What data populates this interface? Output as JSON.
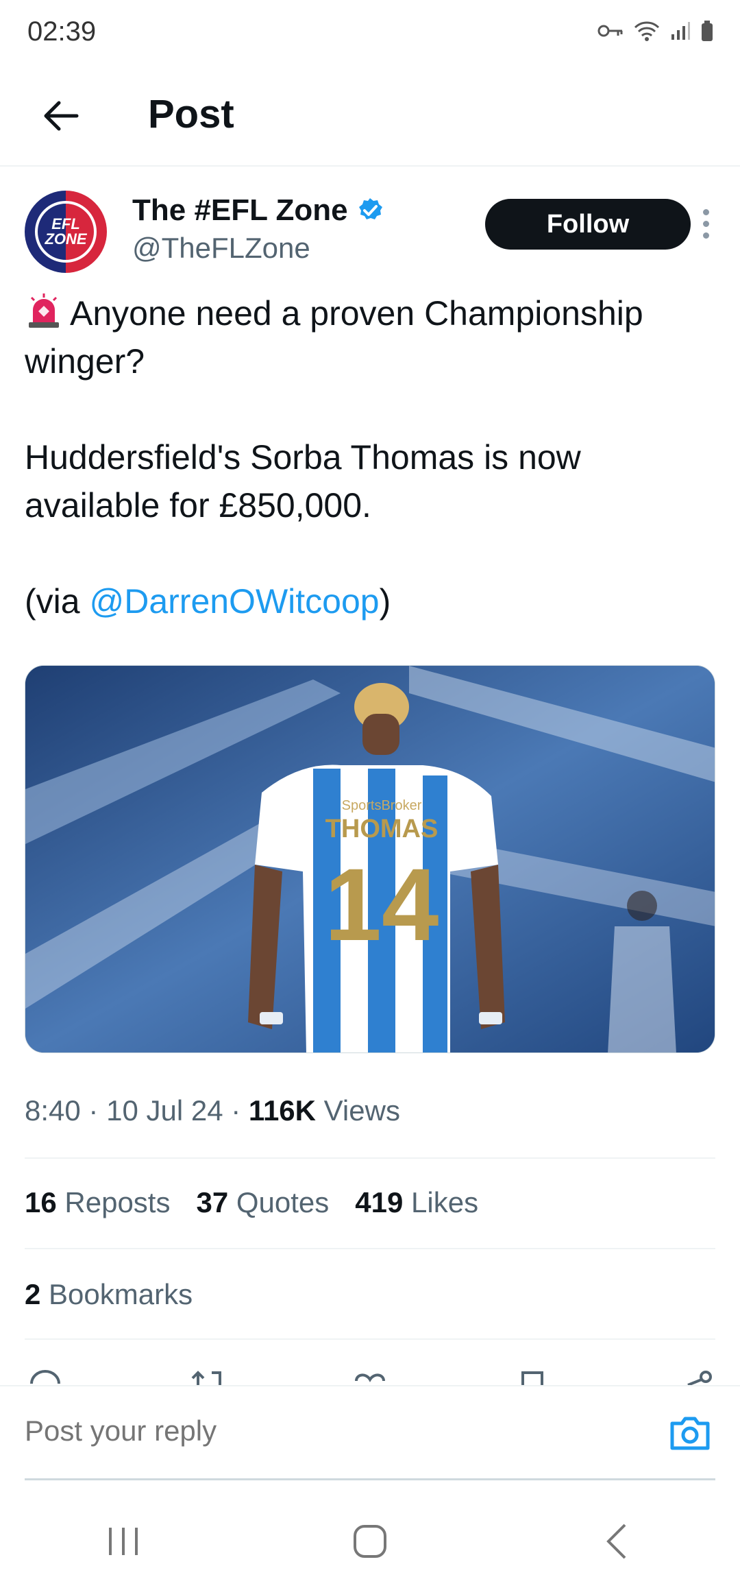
{
  "status_bar": {
    "time": "02:39"
  },
  "header": {
    "title": "Post"
  },
  "author": {
    "name": "The #EFL Zone",
    "handle": "@TheFLZone",
    "avatar_text": "EFL ZONE",
    "follow_label": "Follow"
  },
  "tweet": {
    "line1": "Anyone need a proven Championship winger?",
    "line2": "Huddersfield's Sorba Thomas is now available for £850,000.",
    "via_prefix": "(via ",
    "via_mention": "@DarrenOWitcoop",
    "via_suffix": ")"
  },
  "media": {
    "shirt_name": "THOMAS",
    "shirt_number": "14",
    "sponsor": "SportsBroker"
  },
  "meta": {
    "time": "8:40",
    "date": "10 Jul 24",
    "views_count": "116K",
    "views_label": "Views",
    "separator": "·"
  },
  "stats": {
    "reposts_count": "16",
    "reposts_label": "Reposts",
    "quotes_count": "37",
    "quotes_label": "Quotes",
    "likes_count": "419",
    "likes_label": "Likes",
    "bookmarks_count": "2",
    "bookmarks_label": "Bookmarks"
  },
  "reply": {
    "placeholder": "Post your reply"
  },
  "colors": {
    "accent": "#1d9bf0",
    "text": "#0f1419",
    "muted": "#536471"
  }
}
